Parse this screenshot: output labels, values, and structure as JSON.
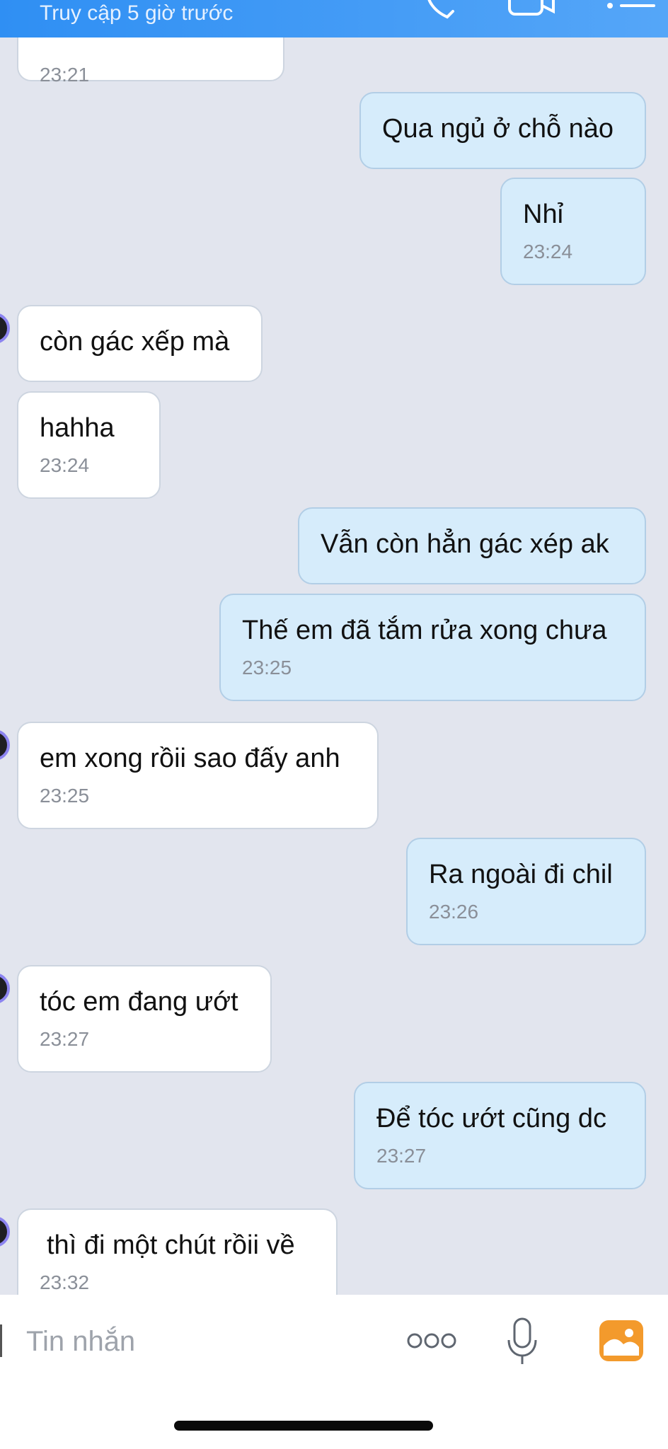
{
  "header": {
    "status": "Truy cập 5 giờ trước",
    "icons": [
      "phone-icon",
      "video-icon",
      "menu-icon"
    ]
  },
  "messages": [
    {
      "dir": "in",
      "time": "23:21"
    },
    {
      "dir": "out",
      "text": "Qua ngủ ở chỗ nào"
    },
    {
      "dir": "out",
      "text": "Nhỉ",
      "time": "23:24"
    },
    {
      "dir": "in",
      "text": "còn gác xếp mà"
    },
    {
      "dir": "in",
      "text": "hahha",
      "time": "23:24"
    },
    {
      "dir": "out",
      "text": "Vẫn còn hẳn gác xép ak"
    },
    {
      "dir": "out",
      "text": "Thế em đã tắm rửa xong chưa",
      "time": "23:25"
    },
    {
      "dir": "in",
      "text": "em xong rồii sao đấy anh",
      "time": "23:25"
    },
    {
      "dir": "out",
      "text": "Ra ngoài đi chil",
      "time": "23:26"
    },
    {
      "dir": "in",
      "text": "tóc em đang ướt",
      "time": "23:27"
    },
    {
      "dir": "out",
      "text": "Để tóc ướt cũng dc",
      "time": "23:27"
    },
    {
      "dir": "in",
      "text": "thì đi một chút rồii về",
      "time": "23:32"
    }
  ],
  "input": {
    "placeholder": "Tin nhắn",
    "icons": [
      "more-options-icon",
      "microphone-icon",
      "gallery-icon"
    ]
  },
  "colors": {
    "header": "#3a95f5",
    "background": "#e2e5ee",
    "incoming_bubble": "#ffffff",
    "outgoing_bubble": "#d6ecfb",
    "gallery_icon": "#f39a2c"
  }
}
